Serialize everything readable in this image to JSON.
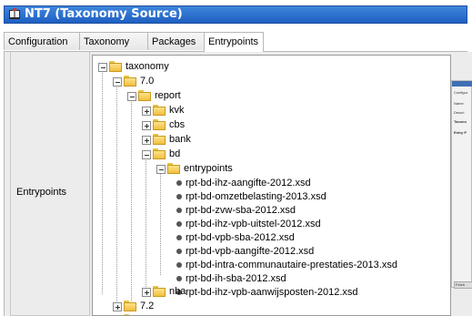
{
  "window": {
    "title": "NT7 (Taxonomy Source)",
    "icon": "book-icon"
  },
  "tabs": [
    {
      "label": "Configuration",
      "active": false
    },
    {
      "label": "Taxonomy",
      "active": false
    },
    {
      "label": "Packages",
      "active": false
    },
    {
      "label": "Entrypoints",
      "active": true
    }
  ],
  "row_label": "Entrypoints",
  "tree": {
    "root": "taxonomy",
    "version_1": "7.0",
    "report": "report",
    "folders": [
      "kvk",
      "cbs",
      "bank",
      "bd"
    ],
    "entrypoints_folder": "entrypoints",
    "files": [
      "rpt-bd-ihz-aangifte-2012.xsd",
      "rpt-bd-omzetbelasting-2013.xsd",
      "rpt-bd-zvw-sba-2012.xsd",
      "rpt-bd-ihz-vpb-uitstel-2012.xsd",
      "rpt-bd-vpb-sba-2012.xsd",
      "rpt-bd-vpb-aangifte-2012.xsd",
      "rpt-bd-intra-communautaire-prestaties-2013.xsd",
      "rpt-bd-ih-sba-2012.xsd",
      "rpt-bd-ihz-vpb-aanwijsposten-2012.xsd"
    ],
    "nba": "nba",
    "version_2": "7.2"
  },
  "thumbnail": {
    "lines": [
      "Configur",
      "Name",
      "Descri",
      "Taxono",
      "Entry P"
    ],
    "button": "Fetch"
  }
}
